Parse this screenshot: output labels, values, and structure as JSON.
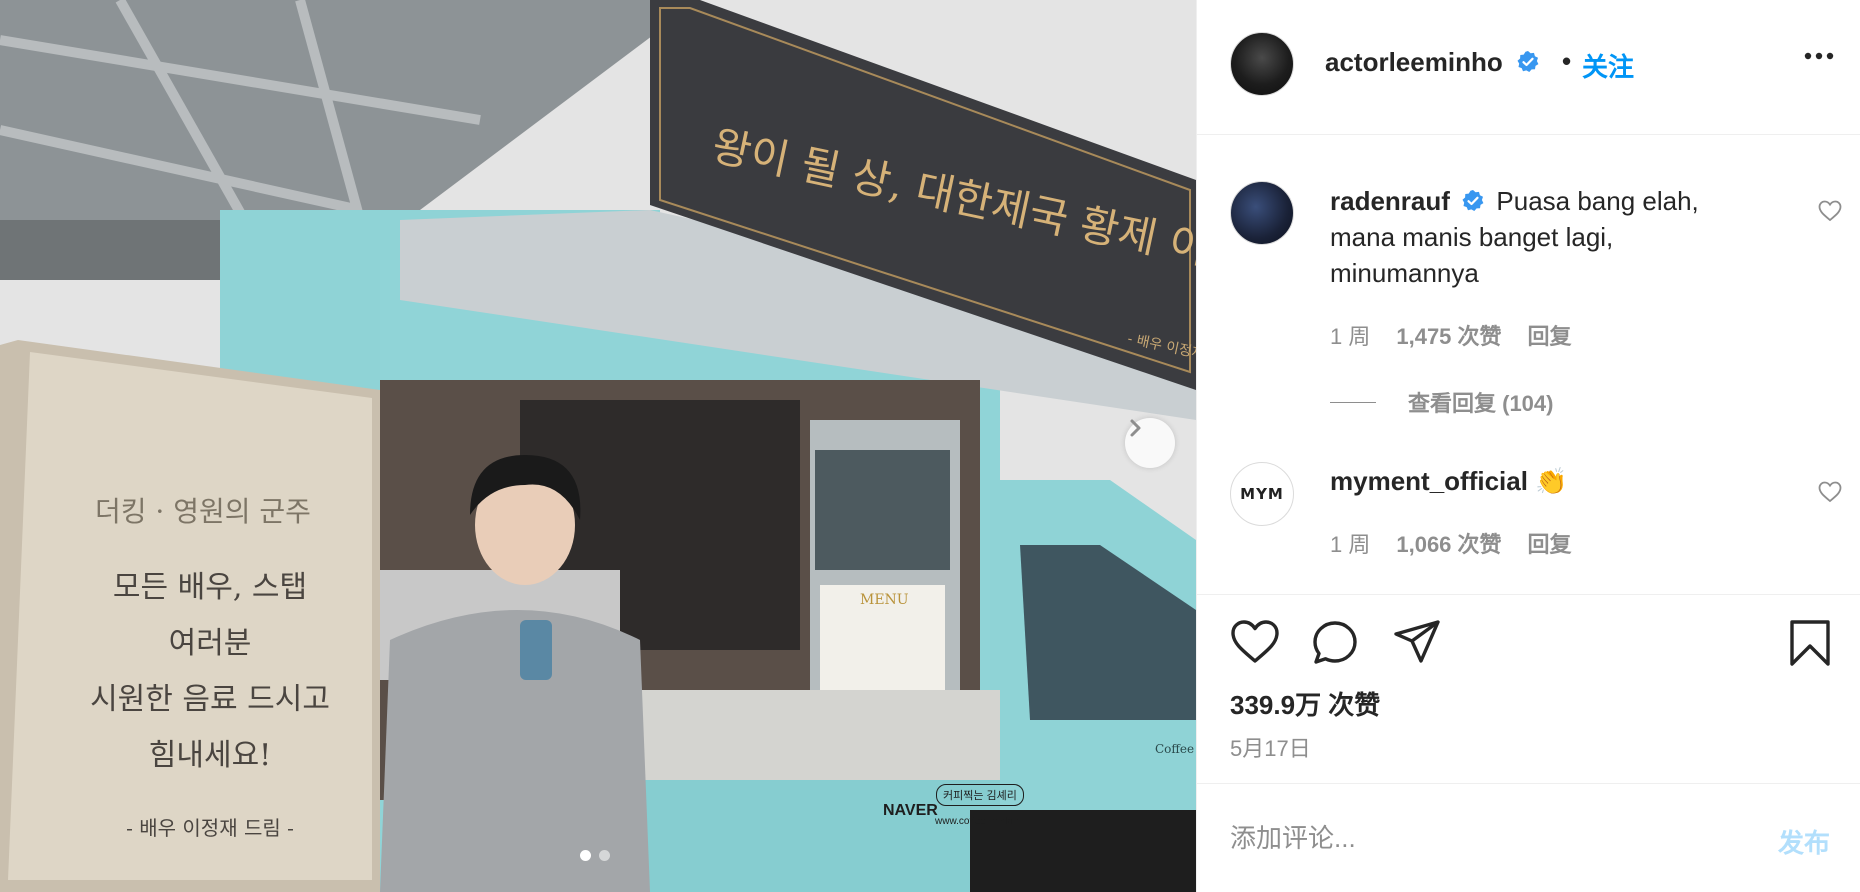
{
  "post": {
    "author": "actorleeminho",
    "separator": "•",
    "follow_label": "关注",
    "likes_total": "339.9万 次赞",
    "date": "5月17日"
  },
  "photo": {
    "banner_text": "왕이 될 상, 대한제국 황제 이곤 만세",
    "banner_sub": "- 배우 이정재 드림",
    "poster_logo": "더킹 · 영원의 군주",
    "poster_line1": "모든 배우, 스탭",
    "poster_line2": "여러분",
    "poster_line3": "시원한 음료 드시고",
    "poster_line4": "힘내세요!",
    "poster_sign": "- 배우 이정재 드림 -",
    "menu_label": "MENU",
    "truck_brand": "NAVER",
    "truck_sticker": "커피찍는 김셰리",
    "truck_url": "www.coffee_mnkim",
    "truck_door": "Coffee",
    "carousel_index": 1,
    "carousel_total": 2
  },
  "comments": [
    {
      "user": "radenrauf",
      "verified": true,
      "text": "Puasa bang elah, mana manis banget lagi, minumannya",
      "time": "1 周",
      "likes": "1,475 次赞",
      "reply_label": "回复",
      "view_replies": "查看回复 (104)"
    },
    {
      "user": "myment_official",
      "verified": false,
      "text": "👏",
      "avatar_text": "MYM",
      "time": "1 周",
      "likes": "1,066 次赞",
      "reply_label": "回复"
    }
  ],
  "add_comment": {
    "placeholder": "添加评论...",
    "post_label": "发布"
  },
  "colors": {
    "accent": "#0095f6",
    "verified": "#3897f0",
    "muted": "#8e8e8e",
    "post_disabled": "#b2dffc",
    "truck_teal": "#8fd3d6"
  },
  "icons": [
    "verified-badge-icon",
    "more-options-icon",
    "heart-icon",
    "comment-icon",
    "share-icon",
    "bookmark-icon",
    "chevron-right-icon"
  ]
}
